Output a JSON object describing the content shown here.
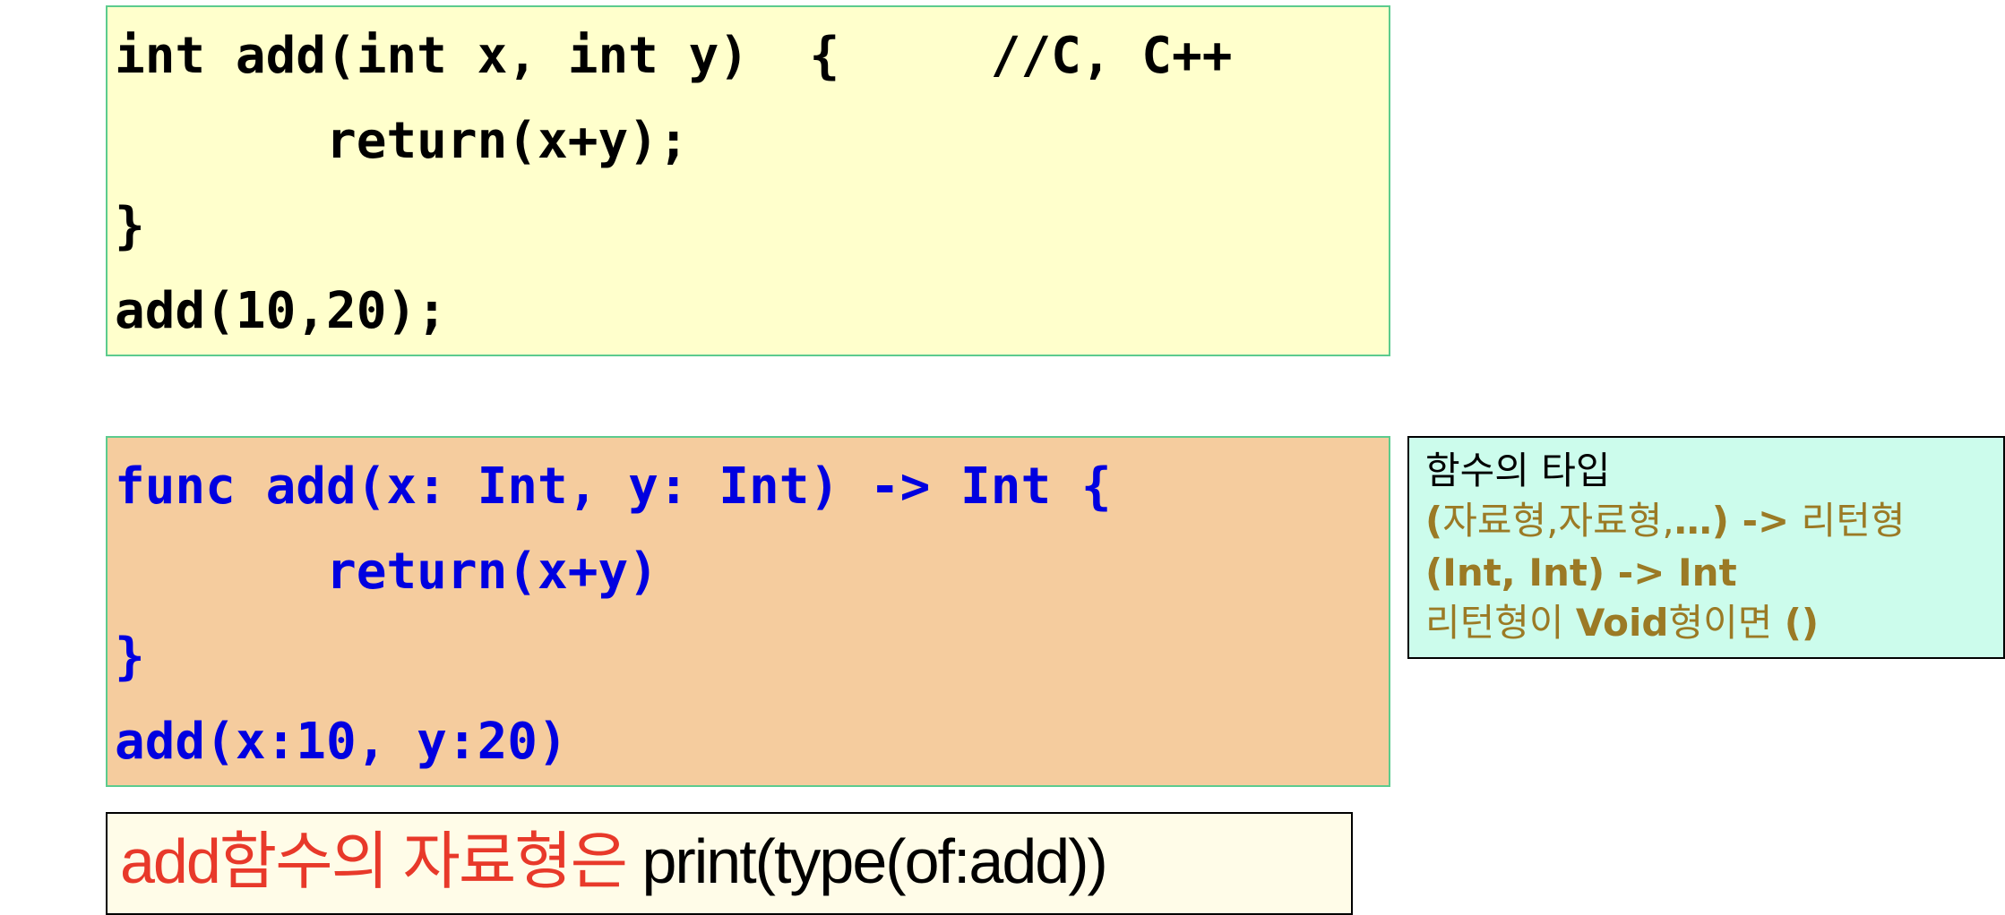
{
  "c_code": {
    "lines": [
      "int add(int x, int y)  {     //C, C++",
      "       return(x+y);",
      "}",
      "add(10,20);"
    ]
  },
  "swift_code": {
    "lines": [
      "func add(x: Int, y: Int) -> Int {",
      "       return(x+y)",
      "}",
      "add(x:10, y:20)"
    ]
  },
  "note": {
    "heading": "함수의 타입",
    "line1": {
      "open": "(",
      "middle": "자료형,자료형,",
      "close": "…) ->",
      "end": " 리턴형"
    },
    "line2": "(Int, Int) -> Int",
    "line3": {
      "part1": "리턴형이 ",
      "void": "Void",
      "part2": "형이면 ",
      "paren": "()"
    }
  },
  "bottom": {
    "red_text": "add함수의 자료형은 ",
    "black_text": "print(type(of:add))"
  },
  "colors": {
    "c_box_bg": "#ffffcc",
    "swift_box_bg": "#f5cc9e",
    "swift_code": "#0000e0",
    "note_bg": "#ccfcec",
    "note_text": "#9b7a25",
    "bottom_red": "#e8392a",
    "box_border": "#5ccb8e"
  }
}
